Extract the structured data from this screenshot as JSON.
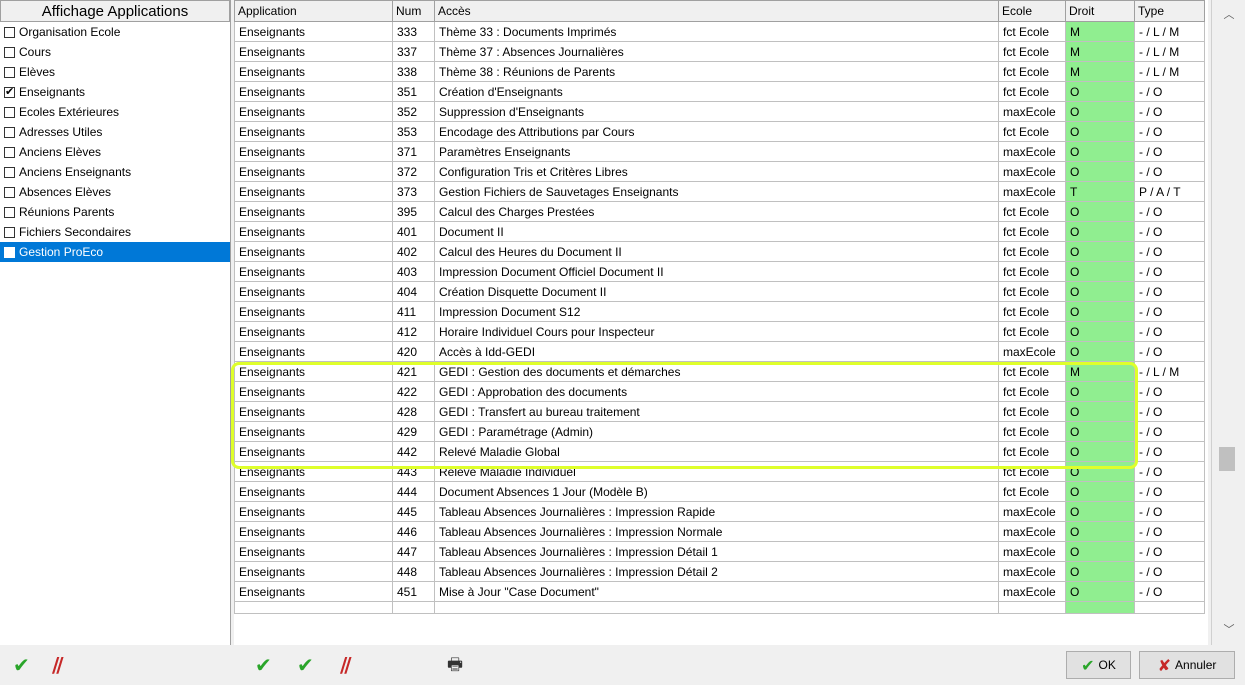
{
  "left_panel": {
    "header": "Affichage Applications",
    "items": [
      {
        "label": "Organisation Ecole",
        "checked": false,
        "selected": false
      },
      {
        "label": "Cours",
        "checked": false,
        "selected": false
      },
      {
        "label": "Elèves",
        "checked": false,
        "selected": false
      },
      {
        "label": "Enseignants",
        "checked": true,
        "selected": false
      },
      {
        "label": "Ecoles Extérieures",
        "checked": false,
        "selected": false
      },
      {
        "label": "Adresses Utiles",
        "checked": false,
        "selected": false
      },
      {
        "label": "Anciens Elèves",
        "checked": false,
        "selected": false
      },
      {
        "label": "Anciens Enseignants",
        "checked": false,
        "selected": false
      },
      {
        "label": "Absences Elèves",
        "checked": false,
        "selected": false
      },
      {
        "label": "Réunions Parents",
        "checked": false,
        "selected": false
      },
      {
        "label": "Fichiers Secondaires",
        "checked": false,
        "selected": false
      },
      {
        "label": "Gestion ProEco",
        "checked": false,
        "selected": true
      }
    ]
  },
  "table": {
    "columns": [
      "Application",
      "Num",
      "Accès",
      "Ecole",
      "Droit",
      "Type"
    ],
    "rows": [
      [
        "Enseignants",
        "333",
        "Thème 33 : Documents Imprimés",
        "fct Ecole",
        "M",
        "- / L / M"
      ],
      [
        "Enseignants",
        "337",
        "Thème 37 : Absences Journalières",
        "fct Ecole",
        "M",
        "- / L / M"
      ],
      [
        "Enseignants",
        "338",
        "Thème 38 : Réunions de Parents",
        "fct Ecole",
        "M",
        "- / L / M"
      ],
      [
        "Enseignants",
        "351",
        "Création d'Enseignants",
        "fct Ecole",
        "O",
        "- / O"
      ],
      [
        "Enseignants",
        "352",
        "Suppression d'Enseignants",
        "maxEcole",
        "O",
        "- / O"
      ],
      [
        "Enseignants",
        "353",
        "Encodage des Attributions par Cours",
        "fct Ecole",
        "O",
        "- / O"
      ],
      [
        "Enseignants",
        "371",
        "Paramètres Enseignants",
        "maxEcole",
        "O",
        "- / O"
      ],
      [
        "Enseignants",
        "372",
        "Configuration Tris et Critères Libres",
        "maxEcole",
        "O",
        "- / O"
      ],
      [
        "Enseignants",
        "373",
        "Gestion Fichiers de Sauvetages Enseignants",
        "maxEcole",
        "T",
        "P / A / T"
      ],
      [
        "Enseignants",
        "395",
        "Calcul des Charges Prestées",
        "fct Ecole",
        "O",
        "- / O"
      ],
      [
        "Enseignants",
        "401",
        "Document II",
        "fct Ecole",
        "O",
        "- / O"
      ],
      [
        "Enseignants",
        "402",
        "Calcul des Heures du Document II",
        "fct Ecole",
        "O",
        "- / O"
      ],
      [
        "Enseignants",
        "403",
        "Impression Document Officiel Document II",
        "fct Ecole",
        "O",
        "- / O"
      ],
      [
        "Enseignants",
        "404",
        "Création Disquette Document II",
        "fct Ecole",
        "O",
        "- / O"
      ],
      [
        "Enseignants",
        "411",
        "Impression Document S12",
        "fct Ecole",
        "O",
        "- / O"
      ],
      [
        "Enseignants",
        "412",
        "Horaire Individuel Cours pour Inspecteur",
        "fct Ecole",
        "O",
        "- / O"
      ],
      [
        "Enseignants",
        "420",
        "Accès à Idd-GEDI",
        "maxEcole",
        "O",
        "- / O"
      ],
      [
        "Enseignants",
        "421",
        "GEDI : Gestion des documents et démarches",
        "fct Ecole",
        "M",
        "- / L / M"
      ],
      [
        "Enseignants",
        "422",
        "GEDI : Approbation des documents",
        "fct Ecole",
        "O",
        "- / O"
      ],
      [
        "Enseignants",
        "428",
        "GEDI : Transfert au bureau traitement",
        "fct Ecole",
        "O",
        "- / O"
      ],
      [
        "Enseignants",
        "429",
        "GEDI : Paramétrage (Admin)",
        "fct Ecole",
        "O",
        "- / O"
      ],
      [
        "Enseignants",
        "442",
        "Relevé Maladie Global",
        "fct Ecole",
        "O",
        "- / O"
      ],
      [
        "Enseignants",
        "443",
        "Relevé Maladie Individuel",
        "fct Ecole",
        "O",
        "- / O"
      ],
      [
        "Enseignants",
        "444",
        "Document Absences 1 Jour (Modèle B)",
        "fct Ecole",
        "O",
        "- / O"
      ],
      [
        "Enseignants",
        "445",
        "Tableau Absences Journalières : Impression Rapide",
        "maxEcole",
        "O",
        "- / O"
      ],
      [
        "Enseignants",
        "446",
        "Tableau Absences Journalières : Impression Normale",
        "maxEcole",
        "O",
        "- / O"
      ],
      [
        "Enseignants",
        "447",
        "Tableau Absences Journalières : Impression Détail 1",
        "maxEcole",
        "O",
        "- / O"
      ],
      [
        "Enseignants",
        "448",
        "Tableau Absences Journalières : Impression Détail 2",
        "maxEcole",
        "O",
        "- / O"
      ],
      [
        "Enseignants",
        "451",
        "Mise à Jour \"Case Document\"",
        "maxEcole",
        "O",
        "- / O"
      ]
    ]
  },
  "buttons": {
    "ok": "OK",
    "cancel": "Annuler"
  },
  "icons": {
    "check": "✔",
    "slash": "//",
    "preview_print": "🖶"
  },
  "colors": {
    "droit_bg": "#90ee90",
    "selected_bg": "#0078d7",
    "highlight": "#dfff2a"
  }
}
